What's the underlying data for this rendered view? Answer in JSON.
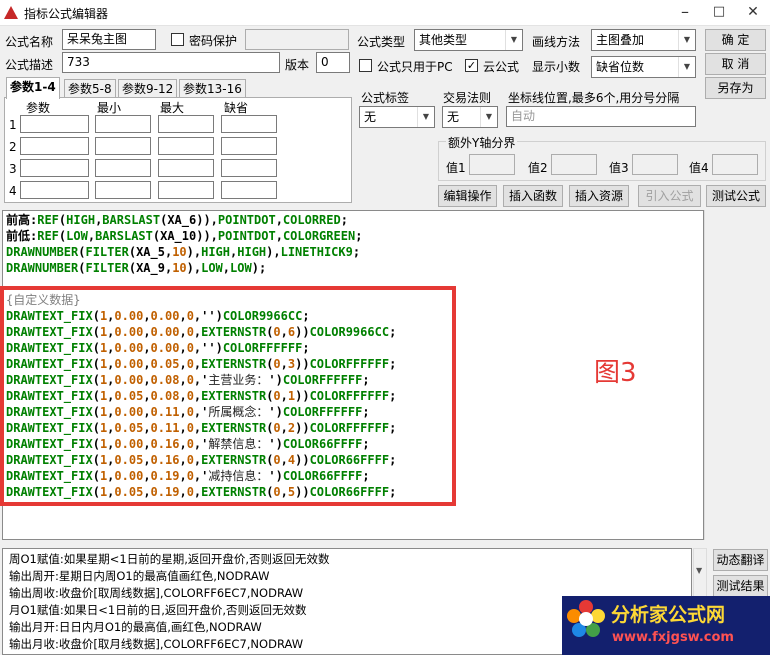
{
  "window": {
    "title": "指标公式编辑器",
    "minimize": "–",
    "maximize": "□",
    "close": "✕"
  },
  "form": {
    "name_label": "公式名称",
    "name_value": "呆呆兔主图",
    "pwd_label": "密码保护",
    "desc_label": "公式描述",
    "desc_value": "733",
    "version_label": "版本",
    "version_value": "0",
    "type_label": "公式类型",
    "type_value": "其他类型",
    "draw_label": "画线方法",
    "draw_value": "主图叠加",
    "pc_only_label": "公式只用于PC",
    "cloud_label": "云公式",
    "decimals_label": "显示小数",
    "decimals_value": "缺省位数",
    "tag_label": "公式标签",
    "tag_value": "无",
    "trade_label": "交易法则",
    "trade_value": "无",
    "coord_label": "坐标线位置,最多6个,用分号分隔",
    "coord_placeholder": "自动",
    "yaxis_label": "额外Y轴分界",
    "v1": "值1",
    "v2": "值2",
    "v3": "值3",
    "v4": "值4"
  },
  "buttons": {
    "ok": "确  定",
    "cancel": "取  消",
    "saveas": "另存为",
    "edit": "编辑操作",
    "insert_func": "插入函数",
    "insert_res": "插入资源",
    "import": "引入公式",
    "test": "测试公式",
    "dyn_translate": "动态翻译",
    "test_result": "测试结果"
  },
  "tabs": [
    "参数1-4",
    "参数5-8",
    "参数9-12",
    "参数13-16"
  ],
  "params": {
    "headers": [
      "参数",
      "最小",
      "最大",
      "缺省"
    ],
    "rows": [
      "1",
      "2",
      "3",
      "4"
    ]
  },
  "code": {
    "lines": [
      [
        [
          "前高:",
          "b"
        ],
        [
          "REF",
          "k"
        ],
        [
          "(",
          "b"
        ],
        [
          "HIGH",
          "k"
        ],
        [
          ",",
          "b"
        ],
        [
          "BARSLAST",
          "k"
        ],
        [
          "(XA_6)),",
          "b"
        ],
        [
          "POINTDOT",
          "k"
        ],
        [
          ",",
          "b"
        ],
        [
          "COLORRED",
          "k"
        ],
        [
          ";",
          "b"
        ]
      ],
      [
        [
          "前低:",
          "b"
        ],
        [
          "REF",
          "k"
        ],
        [
          "(",
          "b"
        ],
        [
          "LOW",
          "k"
        ],
        [
          ",",
          "b"
        ],
        [
          "BARSLAST",
          "k"
        ],
        [
          "(XA_10)),",
          "b"
        ],
        [
          "POINTDOT",
          "k"
        ],
        [
          ",",
          "b"
        ],
        [
          "COLORGREEN",
          "k"
        ],
        [
          ";",
          "b"
        ]
      ],
      [
        [
          "DRAWNUMBER",
          "k"
        ],
        [
          "(",
          "b"
        ],
        [
          "FILTER",
          "k"
        ],
        [
          "(XA_5,",
          "b"
        ],
        [
          "10",
          "n"
        ],
        [
          "),",
          "b"
        ],
        [
          "HIGH",
          "k"
        ],
        [
          ",",
          "b"
        ],
        [
          "HIGH",
          "k"
        ],
        [
          "),",
          "b"
        ],
        [
          "LINETHICK9",
          "k"
        ],
        [
          ";",
          "b"
        ]
      ],
      [
        [
          "DRAWNUMBER",
          "k"
        ],
        [
          "(",
          "b"
        ],
        [
          "FILTER",
          "k"
        ],
        [
          "(XA_9,",
          "b"
        ],
        [
          "10",
          "n"
        ],
        [
          "),",
          "b"
        ],
        [
          "LOW",
          "k"
        ],
        [
          ",",
          "b"
        ],
        [
          "LOW",
          "k"
        ],
        [
          ");",
          "b"
        ]
      ],
      [
        [
          "",
          "b"
        ]
      ],
      [
        [
          "{自定义数据}",
          "cmt"
        ]
      ],
      [
        [
          "DRAWTEXT_FIX",
          "k"
        ],
        [
          "(",
          "b"
        ],
        [
          "1",
          "n"
        ],
        [
          ",",
          "b"
        ],
        [
          "0.00",
          "n"
        ],
        [
          ",",
          "b"
        ],
        [
          "0.00",
          "n"
        ],
        [
          ",",
          "b"
        ],
        [
          "0",
          "n"
        ],
        [
          ",'')",
          "b"
        ],
        [
          "COLOR9966CC",
          "k"
        ],
        [
          ";",
          "b"
        ]
      ],
      [
        [
          "DRAWTEXT_FIX",
          "k"
        ],
        [
          "(",
          "b"
        ],
        [
          "1",
          "n"
        ],
        [
          ",",
          "b"
        ],
        [
          "0.00",
          "n"
        ],
        [
          ",",
          "b"
        ],
        [
          "0.00",
          "n"
        ],
        [
          ",",
          "b"
        ],
        [
          "0",
          "n"
        ],
        [
          ",",
          "b"
        ],
        [
          "EXTERNSTR",
          "k"
        ],
        [
          "(",
          "b"
        ],
        [
          "0",
          "n"
        ],
        [
          ",",
          "b"
        ],
        [
          "6",
          "n"
        ],
        [
          "))",
          "b"
        ],
        [
          "COLOR9966CC",
          "k"
        ],
        [
          ";",
          "b"
        ]
      ],
      [
        [
          "DRAWTEXT_FIX",
          "k"
        ],
        [
          "(",
          "b"
        ],
        [
          "1",
          "n"
        ],
        [
          ",",
          "b"
        ],
        [
          "0.00",
          "n"
        ],
        [
          ",",
          "b"
        ],
        [
          "0.00",
          "n"
        ],
        [
          ",",
          "b"
        ],
        [
          "0",
          "n"
        ],
        [
          ",'')",
          "b"
        ],
        [
          "COLORFFFFFF",
          "k"
        ],
        [
          ";",
          "b"
        ]
      ],
      [
        [
          "DRAWTEXT_FIX",
          "k"
        ],
        [
          "(",
          "b"
        ],
        [
          "1",
          "n"
        ],
        [
          ",",
          "b"
        ],
        [
          "0.00",
          "n"
        ],
        [
          ",",
          "b"
        ],
        [
          "0.05",
          "n"
        ],
        [
          ",",
          "b"
        ],
        [
          "0",
          "n"
        ],
        [
          ",",
          "b"
        ],
        [
          "EXTERNSTR",
          "k"
        ],
        [
          "(",
          "b"
        ],
        [
          "0",
          "n"
        ],
        [
          ",",
          "b"
        ],
        [
          "3",
          "n"
        ],
        [
          "))",
          "b"
        ],
        [
          "COLORFFFFFF",
          "k"
        ],
        [
          ";",
          "b"
        ]
      ],
      [
        [
          "DRAWTEXT_FIX",
          "k"
        ],
        [
          "(",
          "b"
        ],
        [
          "1",
          "n"
        ],
        [
          ",",
          "b"
        ],
        [
          "0.00",
          "n"
        ],
        [
          ",",
          "b"
        ],
        [
          "0.08",
          "n"
        ],
        [
          ",",
          "b"
        ],
        [
          "0",
          "n"
        ],
        [
          ",'",
          "b"
        ],
        [
          "主营业务：",
          "s"
        ],
        [
          "')",
          "b"
        ],
        [
          "COLORFFFFFF",
          "k"
        ],
        [
          ";",
          "b"
        ]
      ],
      [
        [
          "DRAWTEXT_FIX",
          "k"
        ],
        [
          "(",
          "b"
        ],
        [
          "1",
          "n"
        ],
        [
          ",",
          "b"
        ],
        [
          "0.05",
          "n"
        ],
        [
          ",",
          "b"
        ],
        [
          "0.08",
          "n"
        ],
        [
          ",",
          "b"
        ],
        [
          "0",
          "n"
        ],
        [
          ",",
          "b"
        ],
        [
          "EXTERNSTR",
          "k"
        ],
        [
          "(",
          "b"
        ],
        [
          "0",
          "n"
        ],
        [
          ",",
          "b"
        ],
        [
          "1",
          "n"
        ],
        [
          "))",
          "b"
        ],
        [
          "COLORFFFFFF",
          "k"
        ],
        [
          ";",
          "b"
        ]
      ],
      [
        [
          "DRAWTEXT_FIX",
          "k"
        ],
        [
          "(",
          "b"
        ],
        [
          "1",
          "n"
        ],
        [
          ",",
          "b"
        ],
        [
          "0.00",
          "n"
        ],
        [
          ",",
          "b"
        ],
        [
          "0.11",
          "n"
        ],
        [
          ",",
          "b"
        ],
        [
          "0",
          "n"
        ],
        [
          ",'",
          "b"
        ],
        [
          "所属概念：",
          "s"
        ],
        [
          "')",
          "b"
        ],
        [
          "COLORFFFFFF",
          "k"
        ],
        [
          ";",
          "b"
        ]
      ],
      [
        [
          "DRAWTEXT_FIX",
          "k"
        ],
        [
          "(",
          "b"
        ],
        [
          "1",
          "n"
        ],
        [
          ",",
          "b"
        ],
        [
          "0.05",
          "n"
        ],
        [
          ",",
          "b"
        ],
        [
          "0.11",
          "n"
        ],
        [
          ",",
          "b"
        ],
        [
          "0",
          "n"
        ],
        [
          ",",
          "b"
        ],
        [
          "EXTERNSTR",
          "k"
        ],
        [
          "(",
          "b"
        ],
        [
          "0",
          "n"
        ],
        [
          ",",
          "b"
        ],
        [
          "2",
          "n"
        ],
        [
          "))",
          "b"
        ],
        [
          "COLORFFFFFF",
          "k"
        ],
        [
          ";",
          "b"
        ]
      ],
      [
        [
          "DRAWTEXT_FIX",
          "k"
        ],
        [
          "(",
          "b"
        ],
        [
          "1",
          "n"
        ],
        [
          ",",
          "b"
        ],
        [
          "0.00",
          "n"
        ],
        [
          ",",
          "b"
        ],
        [
          "0.16",
          "n"
        ],
        [
          ",",
          "b"
        ],
        [
          "0",
          "n"
        ],
        [
          ",'",
          "b"
        ],
        [
          "解禁信息：",
          "s"
        ],
        [
          "')",
          "b"
        ],
        [
          "COLOR66FFFF",
          "k"
        ],
        [
          ";",
          "b"
        ]
      ],
      [
        [
          "DRAWTEXT_FIX",
          "k"
        ],
        [
          "(",
          "b"
        ],
        [
          "1",
          "n"
        ],
        [
          ",",
          "b"
        ],
        [
          "0.05",
          "n"
        ],
        [
          ",",
          "b"
        ],
        [
          "0.16",
          "n"
        ],
        [
          ",",
          "b"
        ],
        [
          "0",
          "n"
        ],
        [
          ",",
          "b"
        ],
        [
          "EXTERNSTR",
          "k"
        ],
        [
          "(",
          "b"
        ],
        [
          "0",
          "n"
        ],
        [
          ",",
          "b"
        ],
        [
          "4",
          "n"
        ],
        [
          "))",
          "b"
        ],
        [
          "COLOR66FFFF",
          "k"
        ],
        [
          ";",
          "b"
        ]
      ],
      [
        [
          "DRAWTEXT_FIX",
          "k"
        ],
        [
          "(",
          "b"
        ],
        [
          "1",
          "n"
        ],
        [
          ",",
          "b"
        ],
        [
          "0.00",
          "n"
        ],
        [
          ",",
          "b"
        ],
        [
          "0.19",
          "n"
        ],
        [
          ",",
          "b"
        ],
        [
          "0",
          "n"
        ],
        [
          ",'",
          "b"
        ],
        [
          "减持信息：",
          "s"
        ],
        [
          "')",
          "b"
        ],
        [
          "COLOR66FFFF",
          "k"
        ],
        [
          ";",
          "b"
        ]
      ],
      [
        [
          "DRAWTEXT_FIX",
          "k"
        ],
        [
          "(",
          "b"
        ],
        [
          "1",
          "n"
        ],
        [
          ",",
          "b"
        ],
        [
          "0.05",
          "n"
        ],
        [
          ",",
          "b"
        ],
        [
          "0.19",
          "n"
        ],
        [
          ",",
          "b"
        ],
        [
          "0",
          "n"
        ],
        [
          ",",
          "b"
        ],
        [
          "EXTERNSTR",
          "k"
        ],
        [
          "(",
          "b"
        ],
        [
          "0",
          "n"
        ],
        [
          ",",
          "b"
        ],
        [
          "5",
          "n"
        ],
        [
          "))",
          "b"
        ],
        [
          "COLOR66FFFF",
          "k"
        ],
        [
          ";",
          "b"
        ]
      ]
    ]
  },
  "annotation": "图3",
  "help_lines": [
    "周O1赋值:如果星期<1日前的星期,返回开盘价,否则返回无效数",
    "输出周开:星期日内周O1的最高值画红色,NODRAW",
    "输出周收:收盘价[取周线数据],COLORFF6EC7,NODRAW",
    "月O1赋值:如果日<1日前的日,返回开盘价,否则返回无效数",
    "输出月开:日日内月O1的最高值,画红色,NODRAW",
    "输出月收:收盘价[取月线数据],COLORFF6EC7,NODRAW"
  ],
  "watermark": {
    "brand": "分析家公式网",
    "url": "www.fxjgsw.com"
  },
  "colors": {
    "keyword": "#008000",
    "number": "#c06000",
    "highlight_box": "#e53935"
  }
}
